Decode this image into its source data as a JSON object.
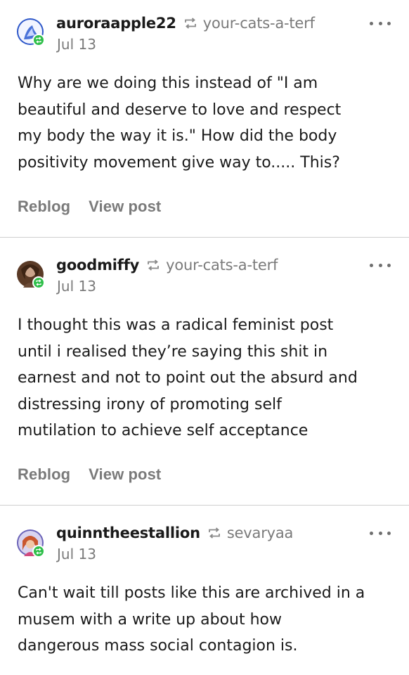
{
  "posts": [
    {
      "username": "auroraapple22",
      "source": "your-cats-a-terf",
      "date": "Jul 13",
      "lines": [
        "Why are we doing this instead of \"I am",
        "beautiful and deserve to love and respect",
        "my body the way it is.\" How did the body",
        "positivity movement give way to..... This?"
      ],
      "actions": [
        "Reblog",
        "View post"
      ]
    },
    {
      "username": "goodmiffy",
      "source": "your-cats-a-terf",
      "date": "Jul 13",
      "lines": [
        "I thought this was a radical feminist post",
        "until i realised they’re saying this shit in",
        "earnest and not to point out the absurd and",
        "distressing irony of promoting self",
        "mutilation to achieve self acceptance"
      ],
      "actions": [
        "Reblog",
        "View post"
      ]
    },
    {
      "username": "quinntheestallion",
      "source": "sevaryaa",
      "date": "Jul 13",
      "lines": [
        "Can't wait till posts like this are archived in a",
        "musem with a write up about how",
        "dangerous mass social contagion is."
      ]
    }
  ],
  "icons": {
    "reblog": "reblog-icon",
    "more": "ellipsis-icon",
    "badge": "reblog-badge-icon"
  },
  "colors": {
    "badge": "#2fbf4a",
    "muted": "#7a7a7a",
    "divider": "#cfcfcf"
  }
}
